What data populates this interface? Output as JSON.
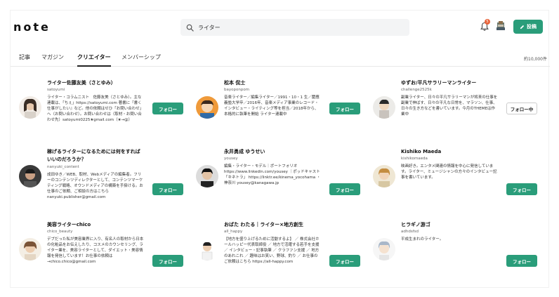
{
  "header": {
    "logo": "note",
    "search_value": "ライター",
    "notification_count": "5",
    "post_label": "投稿"
  },
  "tabs": [
    {
      "label": "記事"
    },
    {
      "label": "マガジン"
    },
    {
      "label": "クリエイター"
    },
    {
      "label": "メンバーシップ"
    }
  ],
  "result_count": "約10,000件",
  "creators": [
    {
      "name": "ライター佐藤友美（さとゆみ）",
      "handle": "satoyumi",
      "bio": "ライター・コラムニスト　佐藤友美（さとゆみ）。主な連載は、「ちぇ」https://satoyumi.com 著書に『書く仕事がしたい』など。他の依頼はせひ「お問い合わせ」へ（お問い合わせ）。お問い合わせは（取材・お問い合わせ先）satoyumi0225★gmail.com（★→@）",
      "follow_label": "フォロー",
      "following": false
    },
    {
      "name": "松本 侃士",
      "handle": "bayoponpom",
      "bio": "音楽ライター／編集ライター／1991・10・1 生／慶應義塾大学卒／2016年、音楽メディア事業のレコード・インタビュー・ライティング等を担当／2018年から、本格的に執筆を開始 ライター連載中",
      "follow_label": "フォロー",
      "following": false
    },
    {
      "name": "ゆずお/平凡サラリーマンライター",
      "handle": "challenge2525k",
      "bio": "副業ライター、日々の平凡サラリーマンが将来の仕事を副業で伸ばす、日々の平凡な日常を、マラソン、仕事、日々の生き方などを書いています。今月のTHEMEは作業中",
      "follow_label": "フォロー中",
      "following": true
    },
    {
      "name": "稼げるライターになるためには何をすればいいのだろうか？",
      "handle": "nanyuki_content",
      "bio": "成田ゆき／WEB、取材、Webメディアの編集者。フリーのコンテンツディレクターとして、コンテンツマーケティング戦略、オウンドメディアの構築を手掛ける。お仕事のご依頼、ご相談の方はこちら nanyuki.publisher@gmail.com",
      "follow_label": "フォロー",
      "following": false
    },
    {
      "name": "永井勇成 ゆうせい",
      "handle": "yousey",
      "bio": "編集・ライター・モデル｜ポートフォリオ https://www.linkedin.com/yousey ｜ポッドキャスト「キネトラ」 https://linktr.ee/kinema_yocohama ・ 神奈川 yousey@kanagawa.jp",
      "follow_label": "フォロー",
      "following": false
    },
    {
      "name": "Kishiko Maeda",
      "handle": "kishikomaeda",
      "bio": "映画好き。エンタメ関連の情報を中心に発信しています。ライター、ミュージシャンの方々のインタビュー記事を書いています。",
      "follow_label": "フォロー",
      "following": false
    },
    {
      "name": "美容ライターchico",
      "handle": "chico_beauty",
      "bio": "デブだった私が美容業界に入り、有名人の取材から日本の化粧品をお伝えしたり、コスメのカウンセリング、ライター業を、美容ライターとして、ダイエット・美容情報を発信しています！お仕事の依頼は→chico.chico@gmail.com",
      "follow_label": "フォロー",
      "following": false
    },
    {
      "name": "おばた わたる｜ライター×地方創生",
      "handle": "all_happy",
      "bio": "【地方を盛り上げるために活動するよ】 ／ 株式会社ホールハッピー代表取締役 ／ 地方で活躍する若手を支援 ／ インタビュー・記事執筆 ／ クラファン支援 ／ 地方のあれこれ ／ 趣味はお笑い、野球、釣り ／ お仕事のご依頼はこちら https://all-happy.com",
      "follow_label": "フォロー",
      "following": false
    },
    {
      "name": "ヒラギノ游ゴ",
      "handle": "adhdsfsd",
      "bio": "平成生まれのライター。",
      "follow_label": "フォロー",
      "following": false
    }
  ]
}
